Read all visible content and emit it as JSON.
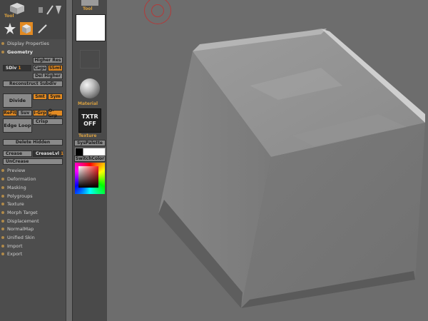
{
  "tool_label": "Tool",
  "palette": {
    "items_top": [
      {
        "label": "Display Properties"
      },
      {
        "label": "Geometry"
      }
    ],
    "geometry": {
      "higher_res": "Higher Res",
      "sdiv_label": "SDiv",
      "sdiv_value": "1",
      "cage": "Cage",
      "ssmt": "SSmt",
      "del_higher": "Del Higher",
      "reconstruct_subdiv": "Reconstruct Subdiv",
      "divide": "Divide",
      "smt": "Smt",
      "sym": "Sym",
      "refit": "ReFit",
      "suv": "Suv",
      "igrp": "I-Grp",
      "ogrp": "O-Grp",
      "edge_loop": "Edge Loop",
      "crisp": "Crisp",
      "delete_hidden": "Delete Hidden",
      "crease": "Crease",
      "crease_lvl": "CreaseLvl",
      "crease_lvl_value": "1",
      "uncrease": "UnCrease"
    },
    "items_bottom": [
      {
        "label": "Preview"
      },
      {
        "label": "Deformation"
      },
      {
        "label": "Masking"
      },
      {
        "label": "Polygroups"
      },
      {
        "label": "Texture"
      },
      {
        "label": "Morph Target"
      },
      {
        "label": "Displacement"
      },
      {
        "label": "NormalMap"
      },
      {
        "label": "Unified Skin"
      },
      {
        "label": "Import"
      },
      {
        "label": "Export"
      }
    ]
  },
  "strip": {
    "tool_label": "Tool",
    "material_label": "Material",
    "texture_label": "Texture",
    "txtr_line1": "TXTR",
    "txtr_line2": "OFF",
    "syspalette": "SysPalette",
    "switchcolor": "SwitchColor"
  }
}
